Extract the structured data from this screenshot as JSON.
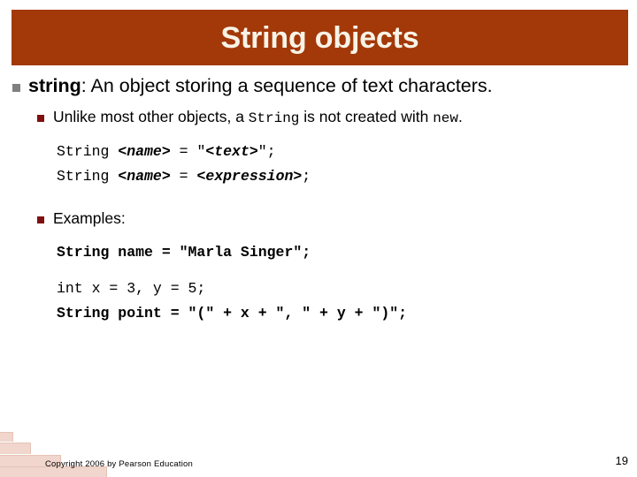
{
  "slide": {
    "title": "String objects",
    "title_bar_color": "#a33808",
    "title_text_color": "#f7f3e7",
    "page_number": "19",
    "copyright": "Copyright 2006 by Pearson Education"
  },
  "bullets": {
    "level1": {
      "marker_color": "#808080",
      "keyword": "string",
      "rest": ": An object storing a sequence of text characters."
    },
    "level2_a": {
      "marker_color": "#7f1010",
      "part1": "Unlike most other objects, a ",
      "mono1": "String",
      "part2": " is not created with ",
      "mono2": "new",
      "part3": "."
    },
    "level2_b": {
      "marker_color": "#7f1010",
      "label": "Examples:"
    }
  },
  "syntax_block": {
    "line1": {
      "type_token": "String ",
      "name_token": "<name>",
      "mid": " = \"",
      "text_token": "<text>",
      "end": "\";"
    },
    "line2": {
      "type_token": "String ",
      "name_token": "<name>",
      "mid": " = ",
      "expr_token": "<expression>",
      "end": ";"
    }
  },
  "examples_block": {
    "line1": "String name = \"Marla Singer\";",
    "line2": "int x = 3, y = 5;",
    "line3": "String point = \"(\" + x + \", \" + y + \")\";"
  }
}
